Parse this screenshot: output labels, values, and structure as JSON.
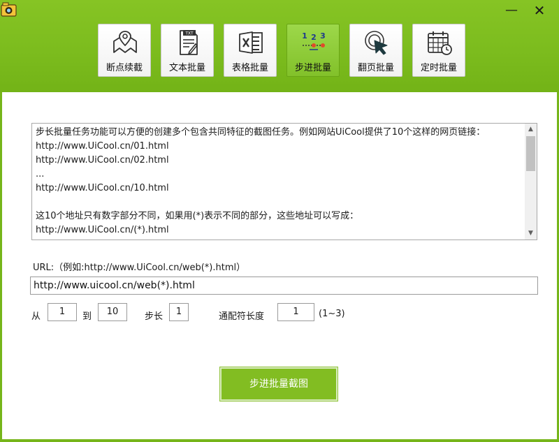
{
  "window": {
    "minimize_label": "—",
    "close_label": "✕",
    "app_icon": "camera-icon",
    "accent": "#76b51a"
  },
  "toolbar": {
    "tabs": [
      {
        "label": "断点续截",
        "icon": "map-pin-icon",
        "active": false
      },
      {
        "label": "文本批量",
        "icon": "txt-file-icon",
        "active": false
      },
      {
        "label": "表格批量",
        "icon": "excel-icon",
        "active": false
      },
      {
        "label": "步进批量",
        "icon": "step-numbers-icon",
        "active": true
      },
      {
        "label": "翻页批量",
        "icon": "cursor-click-icon",
        "active": false
      },
      {
        "label": "定时批量",
        "icon": "calendar-clock-icon",
        "active": false
      }
    ]
  },
  "description": {
    "text": "步长批量任务功能可以方便的创建多个包含共同特征的截图任务。例如网站UiCool提供了10个这样的网页链接：\nhttp://www.UiCool.cn/01.html\nhttp://www.UiCool.cn/02.html\n...\nhttp://www.UiCool.cn/10.html\n\n这10个地址只有数字部分不同，如果用(*)表示不同的部分，这些地址可以写成：\nhttp://www.UiCool.cn/(*).html"
  },
  "url": {
    "hint": "URL:（例如:http://www.UiCool.cn/web(*).html）",
    "value": "http://www.uicool.cn/web(*).html"
  },
  "range": {
    "from_label": "从",
    "from_value": "1",
    "to_label": "到",
    "to_value": "10",
    "step_label": "步长",
    "step_value": "1",
    "wildcard_label": "通配符长度",
    "wildcard_value": "1",
    "wildcard_hint": "(1~3)"
  },
  "action": {
    "label": "步进批量截图"
  }
}
